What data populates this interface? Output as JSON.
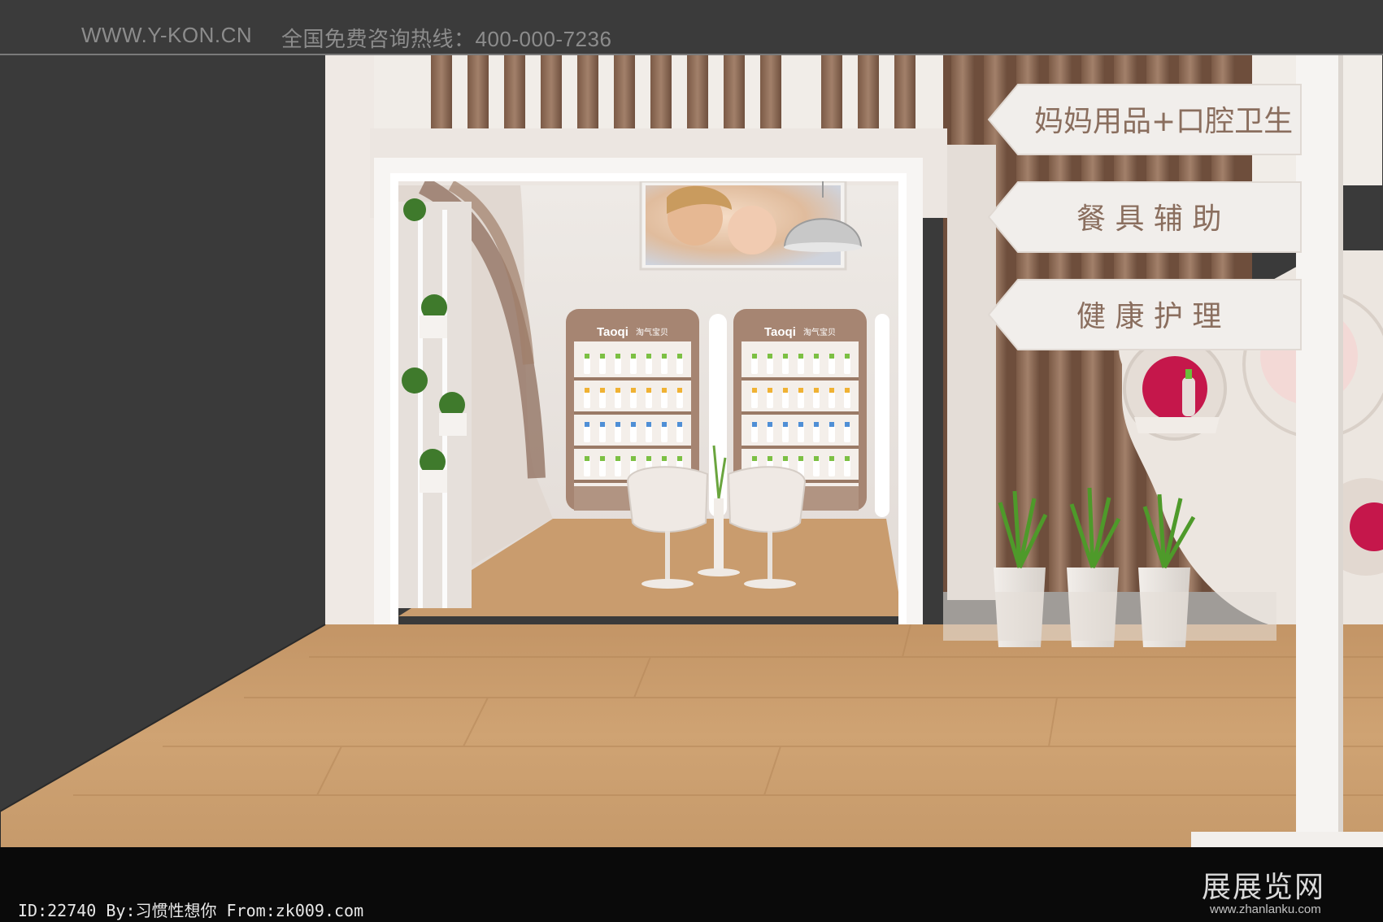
{
  "header": {
    "site": "WWW.Y-KON.CN",
    "hotline": "全国免费咨询热线：400-000-7236"
  },
  "signs": [
    {
      "label": "妈妈用品+口腔卫生"
    },
    {
      "label": "餐 具 辅 助"
    },
    {
      "label": "健 康 护 理"
    }
  ],
  "shelves": {
    "brand": "Taoqi",
    "brand_cn": "淘气宝贝"
  },
  "footer": {
    "credit": "ID:22740 By:习惯性想你 From:zk009.com",
    "watermark_cn": "展展览网",
    "watermark_url": "www.zhanlanku.com"
  },
  "colors": {
    "wall": "#ece6e1",
    "wood_floor": "#c99c6e",
    "slat": "#8a6a55",
    "accent_red": "#c5174b",
    "sign_text": "#8a6e5e"
  }
}
